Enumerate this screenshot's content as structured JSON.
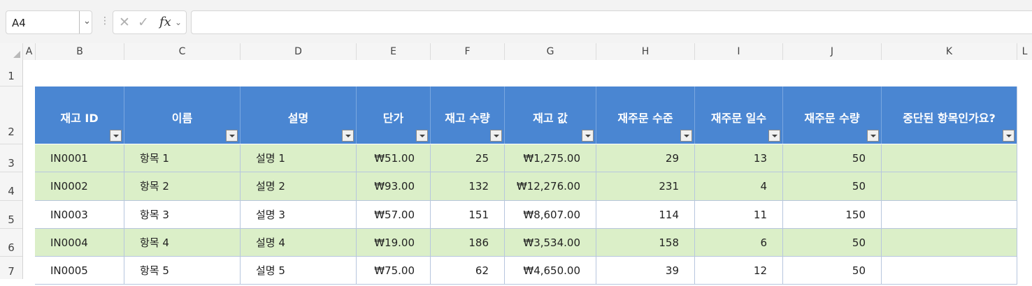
{
  "formula_bar": {
    "name_box": "A4",
    "cancel_icon": "✕",
    "enter_icon": "✓",
    "fx_label": "fx",
    "formula": ""
  },
  "columns": [
    "A",
    "B",
    "C",
    "D",
    "E",
    "F",
    "G",
    "H",
    "I",
    "J",
    "K",
    "L"
  ],
  "rows": [
    "1",
    "2",
    "3",
    "4",
    "5",
    "6",
    "7"
  ],
  "table": {
    "headers": [
      "재고 ID",
      "이름",
      "설명",
      "단가",
      "재고 수량",
      "재고 값",
      "재주문 수준",
      "재주문 일수",
      "재주문 수량",
      "중단된 항목인가요?"
    ],
    "data": [
      [
        "IN0001",
        "항목 1",
        "설명 1",
        "₩51.00",
        "25",
        "₩1,275.00",
        "29",
        "13",
        "50",
        ""
      ],
      [
        "IN0002",
        "항목 2",
        "설명 2",
        "₩93.00",
        "132",
        "₩12,276.00",
        "231",
        "4",
        "50",
        ""
      ],
      [
        "IN0003",
        "항목 3",
        "설명 3",
        "₩57.00",
        "151",
        "₩8,607.00",
        "114",
        "11",
        "150",
        ""
      ],
      [
        "IN0004",
        "항목 4",
        "설명 4",
        "₩19.00",
        "186",
        "₩3,534.00",
        "158",
        "6",
        "50",
        ""
      ],
      [
        "IN0005",
        "항목 5",
        "설명 5",
        "₩75.00",
        "62",
        "₩4,650.00",
        "39",
        "12",
        "50",
        ""
      ]
    ],
    "row_fill": [
      "green",
      "green",
      "white",
      "green",
      "white"
    ]
  },
  "colors": {
    "header_fill": "#4a86d2",
    "band_fill": "#dbefc8"
  }
}
